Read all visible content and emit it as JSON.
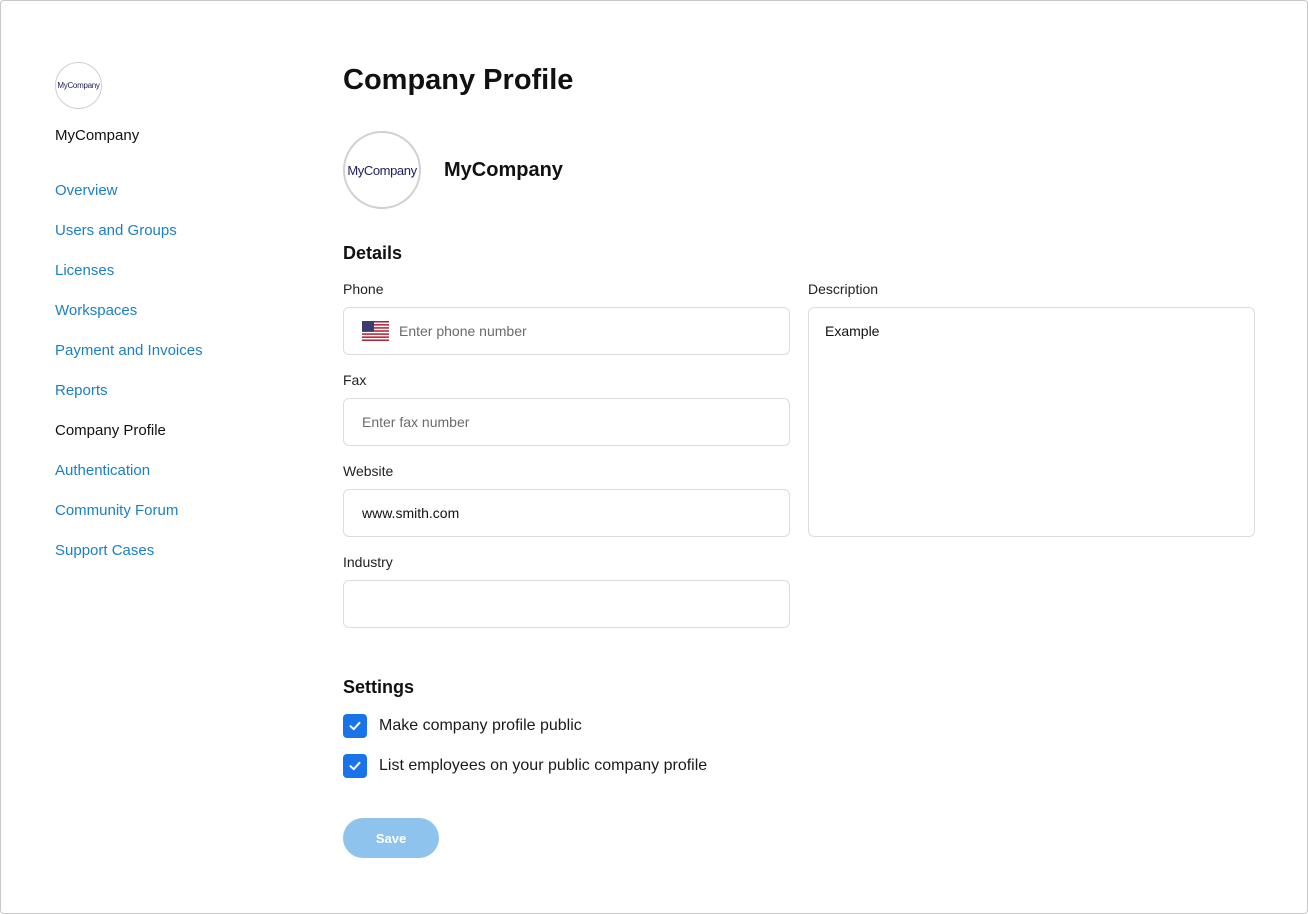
{
  "sidebar": {
    "logo_text": "MyCompany",
    "company_name": "MyCompany",
    "nav": [
      {
        "label": "Overview"
      },
      {
        "label": "Users and Groups"
      },
      {
        "label": "Licenses"
      },
      {
        "label": "Workspaces"
      },
      {
        "label": "Payment and Invoices"
      },
      {
        "label": "Reports"
      },
      {
        "label": "Company Profile",
        "active": true
      },
      {
        "label": "Authentication"
      },
      {
        "label": "Community Forum"
      },
      {
        "label": "Support Cases"
      }
    ]
  },
  "main": {
    "title": "Company Profile",
    "logo_text": "MyCompany",
    "company_name": "MyCompany",
    "details": {
      "title": "Details",
      "phone": {
        "label": "Phone",
        "placeholder": "Enter phone number",
        "flag_icon": "us-flag-icon"
      },
      "fax": {
        "label": "Fax",
        "placeholder": "Enter fax number"
      },
      "website": {
        "label": "Website",
        "value": "www.smith.com"
      },
      "industry": {
        "label": "Industry",
        "value": ""
      },
      "description": {
        "label": "Description",
        "value": "Example"
      }
    },
    "settings": {
      "title": "Settings",
      "options": [
        {
          "label": "Make company profile public",
          "checked": true
        },
        {
          "label": "List employees on your public company profile",
          "checked": true
        }
      ]
    },
    "save_label": "Save"
  },
  "colors": {
    "link": "#1b7fc4",
    "checkbox": "#1a73e8",
    "save_button_disabled": "#8ec3ee"
  }
}
